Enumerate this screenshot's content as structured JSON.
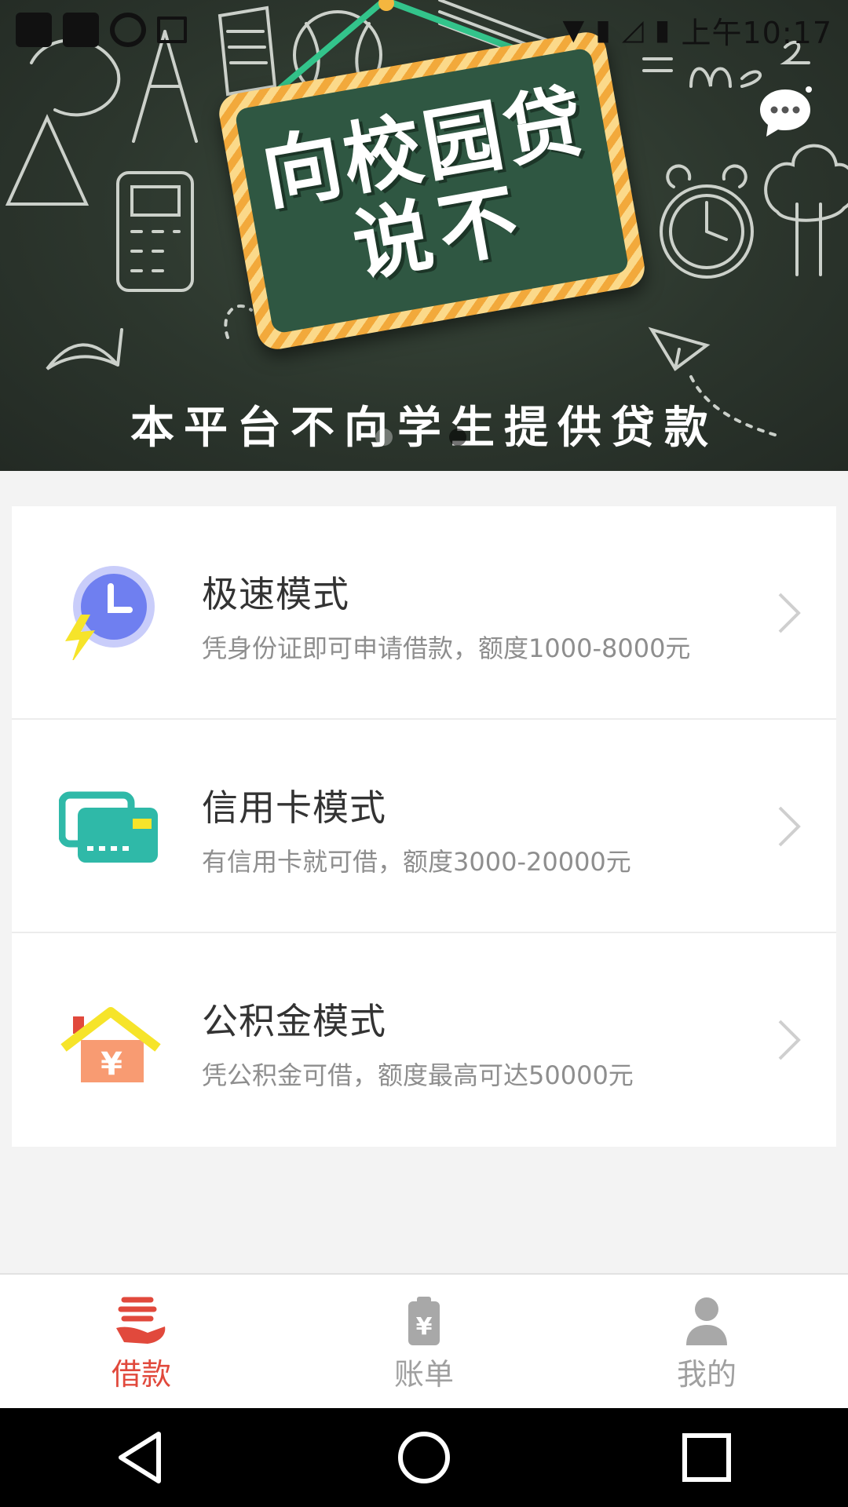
{
  "status_bar": {
    "time": "上午10:17"
  },
  "banner": {
    "board_line1": "向校园贷",
    "board_line2": "说不",
    "caption": "本平台不向学生提供贷款",
    "page_count": 2,
    "active_page": 2
  },
  "modes": [
    {
      "title": "极速模式",
      "subtitle": "凭身份证即可申请借款，额度1000-8000元",
      "icon": "clock-lightning-icon"
    },
    {
      "title": "信用卡模式",
      "subtitle": "有信用卡就可借，额度3000-20000元",
      "icon": "credit-card-icon"
    },
    {
      "title": "公积金模式",
      "subtitle": "凭公积金可借，额度最高可达50000元",
      "icon": "house-yuan-icon"
    }
  ],
  "tabbar": {
    "items": [
      {
        "label": "借款",
        "icon": "loan-hand-icon",
        "active": true
      },
      {
        "label": "账单",
        "icon": "bill-clipboard-icon",
        "active": false
      },
      {
        "label": "我的",
        "icon": "user-icon",
        "active": false
      }
    ]
  },
  "colors": {
    "accent": "#e1493c",
    "board_green": "#2f5742",
    "board_frame": "#f2a93b",
    "teal": "#2fb9a8",
    "periwinkle": "#6f7ff0"
  }
}
